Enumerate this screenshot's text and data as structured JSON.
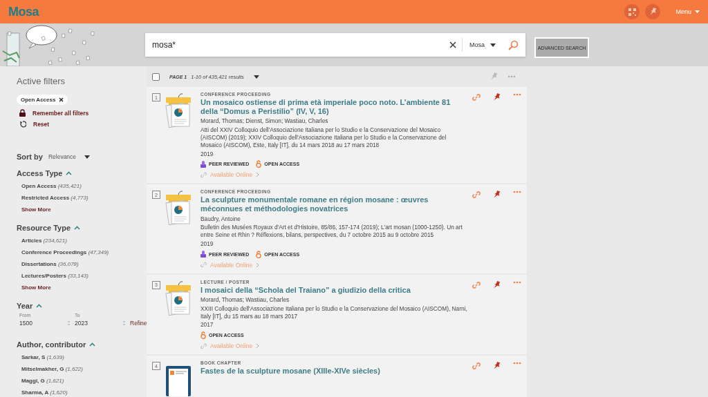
{
  "header": {
    "logo": "Mosa",
    "menu_label": "Menu"
  },
  "search": {
    "value": "mosa*",
    "scope": "Mosa",
    "advanced_label": "ADVANCED SEARCH"
  },
  "toolbar": {
    "select_all_checked": false,
    "page_label": "PAGE 1",
    "results_label": "1-10 of 435,421 results"
  },
  "sidebar": {
    "active_filters_title": "Active filters",
    "active_filters": [
      {
        "label": "Open Access"
      }
    ],
    "remember_label": "Remember all filters",
    "reset_label": "Reset",
    "sort_label": "Sort by",
    "sort_value": "Relevance",
    "facets": [
      {
        "kind": "list",
        "title": "Access Type",
        "expanded": true,
        "items": [
          {
            "label": "Open Access",
            "count": "(435,421)"
          },
          {
            "label": "Restricted Access",
            "count": "(4,773)"
          }
        ],
        "show_more": "Show More"
      },
      {
        "kind": "list",
        "title": "Resource Type",
        "expanded": true,
        "items": [
          {
            "label": "Articles",
            "count": "(234,621)"
          },
          {
            "label": "Conference Proceedings",
            "count": "(47,349)"
          },
          {
            "label": "Dissertations",
            "count": "(36,078)"
          },
          {
            "label": "Lectures/Posters",
            "count": "(33,143)"
          }
        ],
        "show_more": "Show More"
      },
      {
        "kind": "range",
        "title": "Year",
        "expanded": true,
        "from_label": "From",
        "from_value": "1500",
        "to_label": "To",
        "to_value": "2023",
        "refine_label": "Refine"
      },
      {
        "kind": "list",
        "title": "Author, contributor",
        "expanded": true,
        "items": [
          {
            "label": "Sarkar, S",
            "count": "(1,639)"
          },
          {
            "label": "Mitselmakher, G",
            "count": "(1,622)"
          },
          {
            "label": "Maggi, G",
            "count": "(1,621)"
          },
          {
            "label": "Sharma, A",
            "count": "(1,620)"
          }
        ]
      }
    ]
  },
  "results": [
    {
      "number": "1",
      "kind": "proceeding",
      "type_label": "CONFERENCE PROCEEDING",
      "title": "Un mosaico ostiense di prima età imperiale poco noto. L’ambiente 81 della “Domus a Peristilio” (IV, V, 16)",
      "authors": "Morard, Thomas; Dienst, Simon; Wastiau, Charles",
      "source": "Atti del XXIV Colloquio dell'Associazione Italiana per lo Studio e la Conservazione del Mosaico (AISCOM) (2019); XXIV Colloquio dell'Associazione Italiana per lo Studio e la Conservazione del Mosaico (AISCOM), Este, Italy [IT], du 14 mars 2018 au 17 mars 2018",
      "year": "2019",
      "badges": [
        {
          "kind": "peer_reviewed",
          "label": "PEER REVIEWED"
        },
        {
          "kind": "open_access",
          "label": "OPEN ACCESS"
        }
      ],
      "availability": "Available Online"
    },
    {
      "number": "2",
      "kind": "proceeding",
      "type_label": "CONFERENCE PROCEEDING",
      "title": "La sculpture monumentale romane en région mosane : œuvres méconnues et méthodologies novatrices",
      "authors": "Baudry, Antoine",
      "source": "Bulletin des Musées Royaux d'Art et d'Histoire, 85/86, 157-174 (2019); L'art mosan (1000-1250). Un art entre Seine et Rhin ? Réflexions, bilans, perspectives, du 7 octobre 2015 au 9 octobre 2015",
      "year": "2019",
      "badges": [
        {
          "kind": "peer_reviewed",
          "label": "PEER REVIEWED"
        },
        {
          "kind": "open_access",
          "label": "OPEN ACCESS"
        }
      ],
      "availability": "Available Online"
    },
    {
      "number": "3",
      "kind": "proceeding",
      "type_label": "LECTURE / POSTER",
      "title": "I mosaici della “Schola del Traiano” a giudizio della critica",
      "authors": "Morard, Thomas; Wastiau, Charles",
      "source": "XXIII Colloquio dell'Associazione Italiana per lo Studio e la Conservazione del Mosaico (AISCOM), Narni, Italy [IT], du 15 mars au 18 mars 2017",
      "year": "2017",
      "badges": [
        {
          "kind": "open_access",
          "label": "OPEN ACCESS"
        }
      ],
      "availability": "Available Online"
    },
    {
      "number": "4",
      "kind": "book",
      "type_label": "BOOK CHAPTER",
      "title": "Fastes de la sculpture mosane (XIIIe-XIVe siècles)"
    }
  ]
}
